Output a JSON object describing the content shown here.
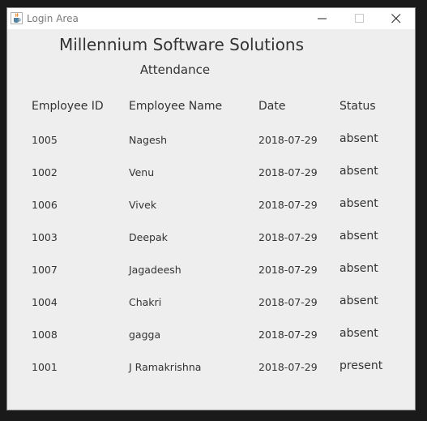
{
  "window": {
    "title": "Login Area",
    "icon": "java-cup-icon",
    "controls": [
      "minimize-icon",
      "maximize-icon",
      "close-icon"
    ]
  },
  "heading": {
    "title": "Millennium Software Solutions",
    "subtitle": "Attendance"
  },
  "table": {
    "headers": [
      "Employee ID",
      "Employee Name",
      "Date",
      "Status"
    ],
    "rows": [
      {
        "id": "1005",
        "name": "Nagesh",
        "date": "2018-07-29",
        "status": "absent"
      },
      {
        "id": "1002",
        "name": "Venu",
        "date": "2018-07-29",
        "status": "absent"
      },
      {
        "id": "1006",
        "name": "Vivek",
        "date": "2018-07-29",
        "status": "absent"
      },
      {
        "id": "1003",
        "name": "Deepak",
        "date": "2018-07-29",
        "status": "absent"
      },
      {
        "id": "1007",
        "name": "Jagadeesh",
        "date": "2018-07-29",
        "status": "absent"
      },
      {
        "id": "1004",
        "name": "Chakri",
        "date": "2018-07-29",
        "status": "absent"
      },
      {
        "id": "1008",
        "name": "gagga",
        "date": "2018-07-29",
        "status": "absent"
      },
      {
        "id": "1001",
        "name": "J Ramakrishna",
        "date": "2018-07-29",
        "status": "present"
      }
    ]
  }
}
